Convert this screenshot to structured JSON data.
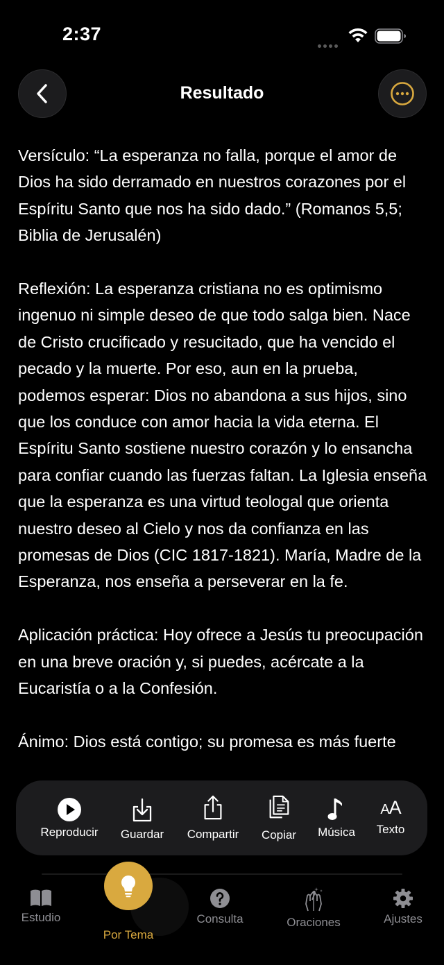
{
  "status": {
    "time": "2:37"
  },
  "nav": {
    "title": "Resultado",
    "back_icon": "chevron-left-icon",
    "more_icon": "ellipsis-circle-icon"
  },
  "colors": {
    "accent": "#d9a93f",
    "background": "#000000",
    "surface": "#1c1c1e",
    "inactive": "#8e8e93"
  },
  "content": {
    "versiculo": "Versículo: “La esperanza no falla, porque el amor de Dios ha sido derramado en nuestros corazones por el Espíritu Santo que nos ha sido dado.” (Romanos 5,5; Biblia de Jerusalén)",
    "reflexion": "Reflexión: La esperanza cristiana no es optimismo ingenuo ni simple deseo de que todo salga bien. Nace de Cristo crucificado y resucitado, que ha vencido el pecado y la muerte. Por eso, aun en la prueba, podemos esperar: Dios no abandona a sus hijos, sino que los conduce con amor hacia la vida eterna. El Espíritu Santo sostiene nuestro corazón y lo ensancha para confiar cuando las fuerzas faltan. La Iglesia enseña que la esperanza es una virtud teologal que orienta nuestro deseo al Cielo y nos da confianza en las promesas de Dios (CIC 1817-1821). María, Madre de la Esperanza, nos enseña a perseverar en la fe.",
    "aplicacion": "Aplicación práctica: Hoy ofrece a Jesús tu preocupación en una breve oración y, si puedes, acércate a la Eucaristía o a la Confesión.",
    "animo": "Ánimo: Dios está contigo; su promesa es más fuerte"
  },
  "toolbar": {
    "play_label": "Reproducir",
    "save_label": "Guardar",
    "share_label": "Compartir",
    "copy_label": "Copiar",
    "music_label": "Música",
    "text_label": "Texto",
    "text_glyph": "AA"
  },
  "tabs": {
    "estudio": "Estudio",
    "por_tema": "Por Tema",
    "consulta": "Consulta",
    "oraciones": "Oraciones",
    "ajustes": "Ajustes"
  }
}
